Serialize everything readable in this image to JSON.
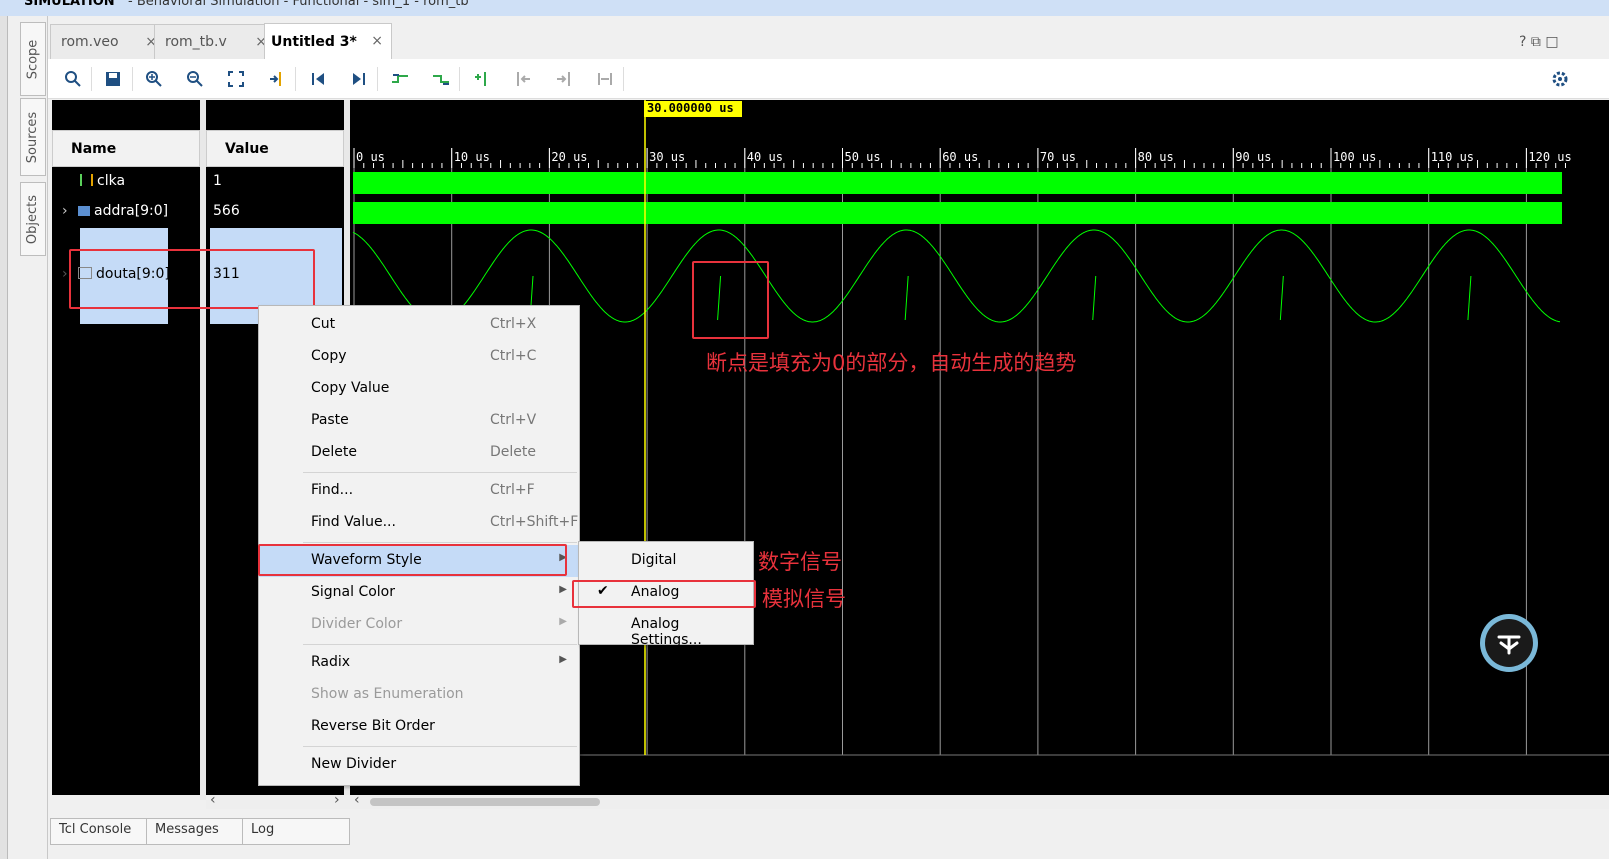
{
  "title_bar": {
    "left": "SIMULATION",
    "right": "- Behavioral Simulation - Functional - sim_1 - rom_tb"
  },
  "side_tabs": [
    "Scope",
    "Sources",
    "Objects"
  ],
  "tabs": [
    {
      "label": "rom.veo",
      "active": false
    },
    {
      "label": "rom_tb.v",
      "active": false
    },
    {
      "label": "Untitled 3*",
      "active": true
    }
  ],
  "tab_close": "×",
  "tab_icons": "? ⧉ □",
  "toolbar_icons": [
    "search-icon",
    "save-icon",
    "zoom-in-icon",
    "zoom-out-icon",
    "zoom-fit-icon",
    "go-to-cursor-icon",
    "go-to-start-icon",
    "go-to-end-icon",
    "previous-transition-icon",
    "next-transition-icon",
    "add-marker-icon",
    "previous-marker-icon",
    "next-marker-icon",
    "swap-cursors-icon"
  ],
  "columns": {
    "name": "Name",
    "value": "Value"
  },
  "signals": [
    {
      "name": "clka",
      "value": "1"
    },
    {
      "name": "addra[9:0]",
      "value": "566"
    },
    {
      "name": "douta[9:0]",
      "value": "311"
    }
  ],
  "cursor_label": "30.000000 us",
  "timeline_ticks": [
    "0 us",
    "10 us",
    "20 us",
    "30 us",
    "40 us",
    "50 us",
    "60 us",
    "70 us",
    "80 us",
    "90 us",
    "100 us",
    "110 us",
    "120 us"
  ],
  "context_menu": {
    "items": [
      {
        "label": "Cut",
        "shortcut": "Ctrl+X"
      },
      {
        "label": "Copy",
        "shortcut": "Ctrl+C"
      },
      {
        "label": "Copy Value",
        "shortcut": ""
      },
      {
        "label": "Paste",
        "shortcut": "Ctrl+V"
      },
      {
        "label": "Delete",
        "shortcut": "Delete"
      },
      {
        "label": "Find...",
        "shortcut": "Ctrl+F"
      },
      {
        "label": "Find Value...",
        "shortcut": "Ctrl+Shift+F"
      },
      {
        "label": "Waveform Style",
        "shortcut": ""
      },
      {
        "label": "Signal Color",
        "shortcut": ""
      },
      {
        "label": "Divider Color",
        "shortcut": ""
      },
      {
        "label": "Radix",
        "shortcut": ""
      },
      {
        "label": "Show as Enumeration",
        "shortcut": ""
      },
      {
        "label": "Reverse Bit Order",
        "shortcut": ""
      },
      {
        "label": "New Divider",
        "shortcut": ""
      }
    ]
  },
  "submenu": {
    "items": [
      {
        "label": "Digital",
        "checked": false
      },
      {
        "label": "Analog",
        "checked": true
      },
      {
        "label": "Analog Settings...",
        "checked": false
      }
    ]
  },
  "annotations": {
    "breakpoint_note": "断点是填充为0的部分，自动生成的趋势",
    "digital_note": "数字信号",
    "analog_note": "模拟信号"
  },
  "bottom_tabs": [
    "Tcl Console",
    "Messages",
    "Log"
  ],
  "colors": {
    "waveform": "#00ff00",
    "cursor": "#ffff00",
    "annotation": "#e8323c",
    "selection": "#c5dbf7"
  }
}
